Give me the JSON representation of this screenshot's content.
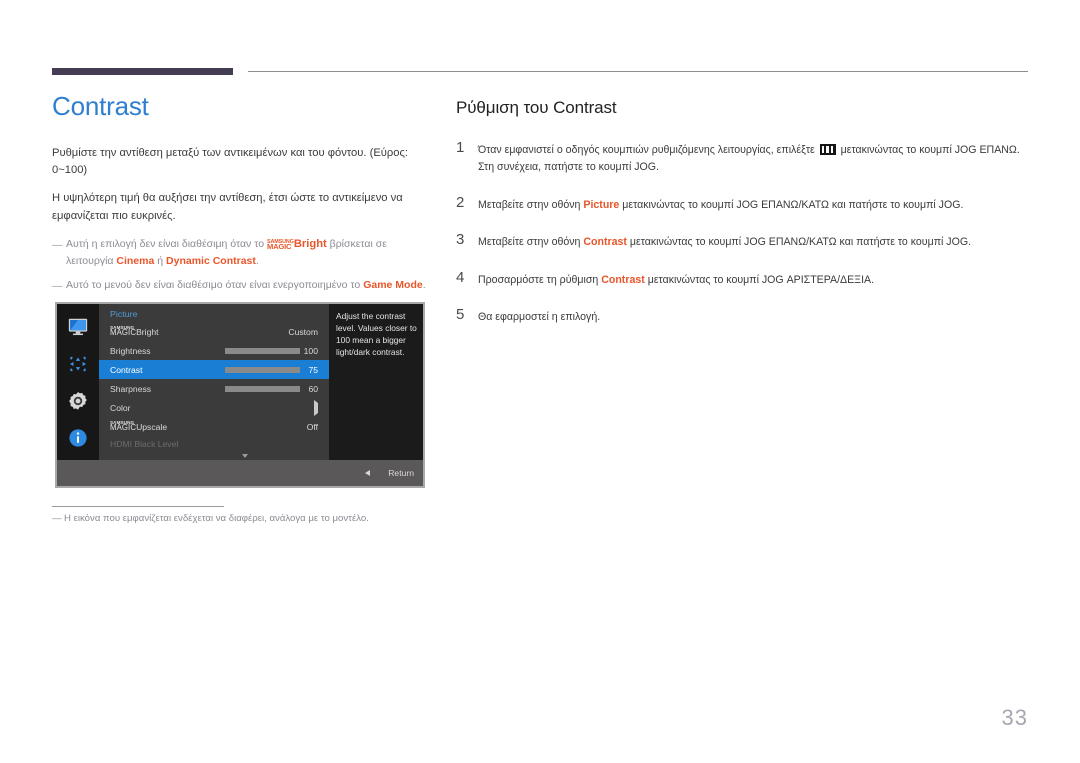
{
  "document": {
    "page_number": "33"
  },
  "left": {
    "title": "Contrast",
    "paragraphs": [
      "Ρυθμίστε την αντίθεση μεταξύ των αντικειμένων και του φόντου. (Εύρος: 0~100)",
      "Η υψηλότερη τιμή θα αυξήσει την αντίθεση, έτσι ώστε το αντικείμενο να εμφανίζεται πιο ευκρινές."
    ],
    "notes": [
      {
        "dash": "―",
        "pre": "Αυτή η επιλογή δεν είναι διαθέσιμη όταν το ",
        "magic_line1": "SAMSUNG",
        "magic_line2": "MAGIC",
        "magic_word": "Bright",
        "mid": " βρίσκεται σε λειτουργία ",
        "kw1": "Cinema",
        "between": " ή ",
        "kw2": "Dynamic Contrast",
        "post": "."
      },
      {
        "dash": "―",
        "pre": "Αυτό το μενού δεν είναι διαθέσιμο όταν είναι ενεργοποιημένο το ",
        "kw1": "Game Mode",
        "post": "."
      }
    ],
    "footnote": {
      "dash": "―",
      "text": "Η εικόνα που εμφανίζεται ενδέχεται να διαφέρει, ανάλογα με το μοντέλο."
    }
  },
  "osd": {
    "menu_title": "Picture",
    "sidebar_icons": [
      "monitor-icon",
      "move-arrows-icon",
      "gear-icon",
      "info-icon"
    ],
    "rows": [
      {
        "id": "magicbright",
        "magic_line1": "SAMSUNG",
        "magic_line2": "MAGIC",
        "label": "Bright",
        "value": "Custom",
        "kind": "value",
        "selected": false
      },
      {
        "id": "brightness",
        "label": "Brightness",
        "value": "100",
        "kind": "slider",
        "percent": 100,
        "selected": false
      },
      {
        "id": "contrast",
        "label": "Contrast",
        "value": "75",
        "kind": "slider",
        "percent": 75,
        "selected": true
      },
      {
        "id": "sharpness",
        "label": "Sharpness",
        "value": "60",
        "kind": "slider",
        "percent": 60,
        "selected": false
      },
      {
        "id": "color",
        "label": "Color",
        "value": "",
        "kind": "submenu",
        "selected": false
      },
      {
        "id": "magicupscale",
        "magic_line1": "SAMSUNG",
        "magic_line2": "MAGIC",
        "label": "Upscale",
        "value": "Off",
        "kind": "value",
        "selected": false
      },
      {
        "id": "hdmi-black-level",
        "label": "HDMI Black Level",
        "value": "",
        "kind": "dim",
        "selected": false
      }
    ],
    "help_text": "Adjust the contrast level. Values closer to 100 mean a bigger light/dark contrast.",
    "return_label": "Return",
    "highlight_color": "#1a7fd4"
  },
  "right": {
    "title": "Ρύθμιση του Contrast",
    "steps": [
      {
        "num": "1",
        "pre": "Όταν εμφανιστεί ο οδηγός κουμπιών ρυθμιζόμενης λειτουργίας, επιλέξτε ",
        "icon": "jog-menu-icon",
        "post": " μετακινώντας το κουμπί JOG ΕΠΑΝΩ. Στη συνέχεια, πατήστε το κουμπί JOG."
      },
      {
        "num": "2",
        "pre": "Μεταβείτε στην οθόνη ",
        "kw": "Picture",
        "post": " μετακινώντας το κουμπί JOG ΕΠΑΝΩ/ΚΑΤΩ και πατήστε το κουμπί JOG."
      },
      {
        "num": "3",
        "pre": "Μεταβείτε στην οθόνη ",
        "kw": "Contrast",
        "post": " μετακινώντας το κουμπί JOG ΕΠΑΝΩ/ΚΑΤΩ και πατήστε το κουμπί JOG."
      },
      {
        "num": "4",
        "pre": "Προσαρμόστε τη ρύθμιση ",
        "kw": "Contrast",
        "post": " μετακινώντας το κουμπί JOG ΑΡΙΣΤΕΡΑ/ΔΕΞΙΑ."
      },
      {
        "num": "5",
        "pre": "Θα εφαρμοστεί η επιλογή.",
        "kw": "",
        "post": ""
      }
    ]
  },
  "colors": {
    "accent_blue": "#2f7fd0",
    "accent_orange": "#e8562a",
    "rule_purple": "#443c52",
    "osd_highlight": "#1a7fd4"
  }
}
